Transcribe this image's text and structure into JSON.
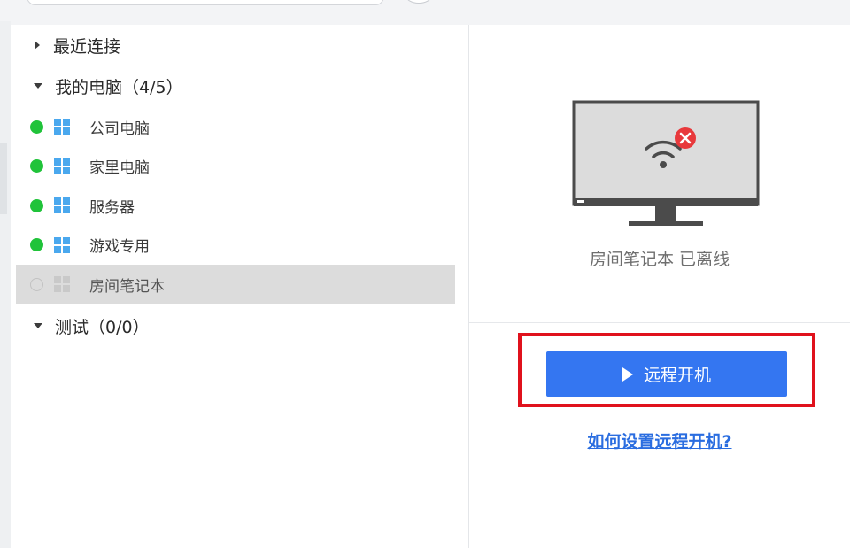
{
  "colors": {
    "accent": "#3476f1",
    "online": "#20c33a",
    "highlight": "#e0111c",
    "link": "#2a6de0",
    "windows": "#4aa8ee",
    "windows_offline": "#c9c9c9",
    "error": "#e8393c"
  },
  "tree": {
    "recent": {
      "label": "最近连接",
      "expanded": false
    },
    "my_computers": {
      "label": "我的电脑（4/5）",
      "expanded": true,
      "devices": [
        {
          "name": "公司电脑",
          "status": "online",
          "os_icon": "windows-icon"
        },
        {
          "name": "家里电脑",
          "status": "online",
          "os_icon": "windows-icon"
        },
        {
          "name": "服务器",
          "status": "online",
          "os_icon": "windows-icon"
        },
        {
          "name": "游戏专用",
          "status": "online",
          "os_icon": "windows-icon"
        },
        {
          "name": "房间笔记本",
          "status": "offline",
          "os_icon": "windows-icon",
          "selected": true
        }
      ]
    },
    "test_group": {
      "label": "测试（0/0）",
      "expanded": true
    }
  },
  "detail": {
    "monitor_icon": "monitor-offline-icon",
    "status_text": "房间笔记本  已离线",
    "wake_button_label": "远程开机",
    "help_link": "如何设置远程开机?"
  }
}
